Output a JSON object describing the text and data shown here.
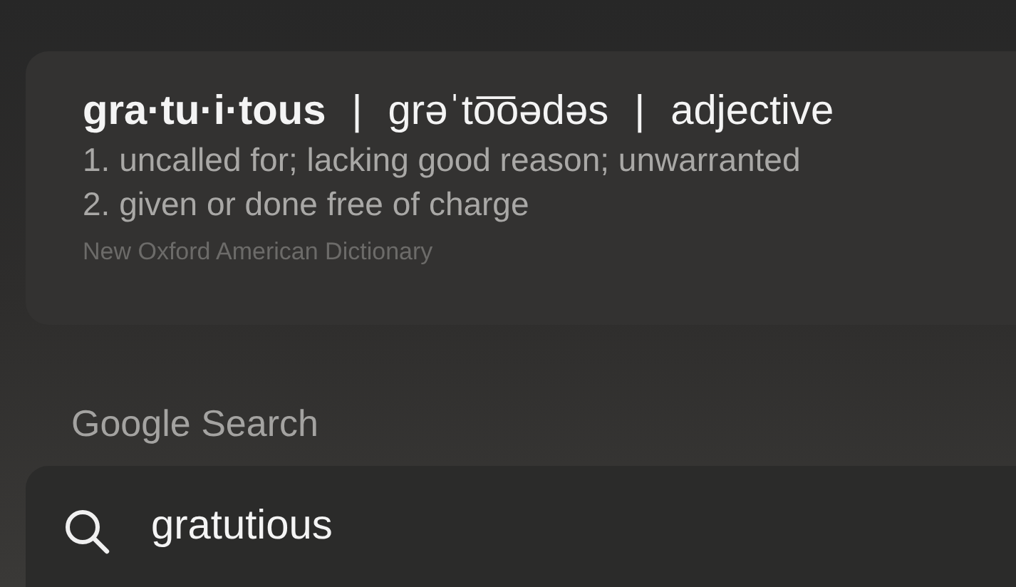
{
  "definition": {
    "line": [
      {
        "kind": "headword",
        "text": "gra·tu·i·tous"
      },
      {
        "kind": "separator",
        "text": "|"
      },
      {
        "kind": "pronunciation",
        "text": "ɡrəˈto͞oədəs"
      },
      {
        "kind": "separator",
        "text": "|"
      },
      {
        "kind": "part_of_speech",
        "text": "adjective"
      }
    ],
    "senses": [
      "1. uncalled for; lacking good reason; unwarranted",
      "2. given or done free of charge"
    ],
    "source": "New Oxford American Dictionary"
  },
  "section_title": "Google Search",
  "search": {
    "query": "gratutious"
  }
}
